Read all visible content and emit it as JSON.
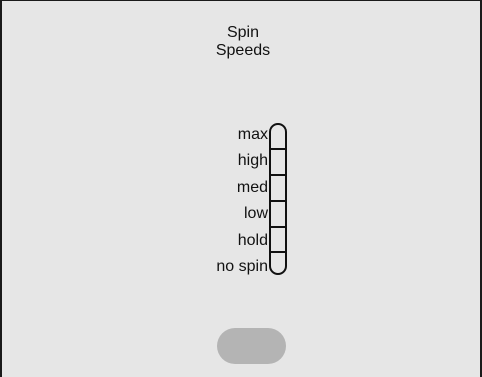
{
  "header": {
    "title_line1": "Spin",
    "title_line2": "Speeds"
  },
  "spin_speeds": {
    "levels": [
      "max",
      "high",
      "med",
      "low",
      "hold",
      "no spin"
    ]
  },
  "colors": {
    "panel_background": "#e6e6e6",
    "border": "#1a1a1a",
    "button": "#b4b4b4"
  }
}
